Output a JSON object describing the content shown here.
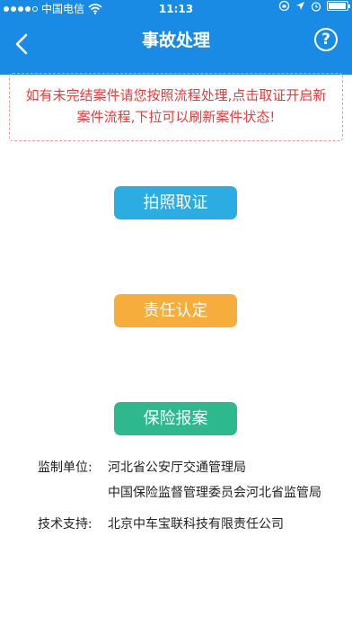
{
  "status": {
    "carrier": "中国电信",
    "time": "11:13",
    "battery_level": 0.95
  },
  "nav": {
    "title": "事故处理",
    "back_icon": "chevron-left-icon",
    "help_label": "?"
  },
  "notice": {
    "line1": "如有未完结案件请您按照流程处理,点击取证开启新",
    "line2": "案件流程,下拉可以刷新案件状态!"
  },
  "actions": {
    "photo_label": "拍照取证",
    "liability_label": "责任认定",
    "insurance_label": "保险报案"
  },
  "footer": {
    "supervision_label": "监制单位:",
    "supervision_unit_1": "河北省公安厅交通管理局",
    "supervision_unit_2": "中国保险监督管理委员会河北省监管局",
    "tech_label": "技术支持:",
    "tech_company": "北京中车宝联科技有限责任公司"
  },
  "colors": {
    "topbar": "#1a8be4",
    "notice_text": "#ec3b3b",
    "photo_button": "#2bace2",
    "liability_button": "#f6ad3c",
    "insurance_button": "#2eb88e"
  }
}
